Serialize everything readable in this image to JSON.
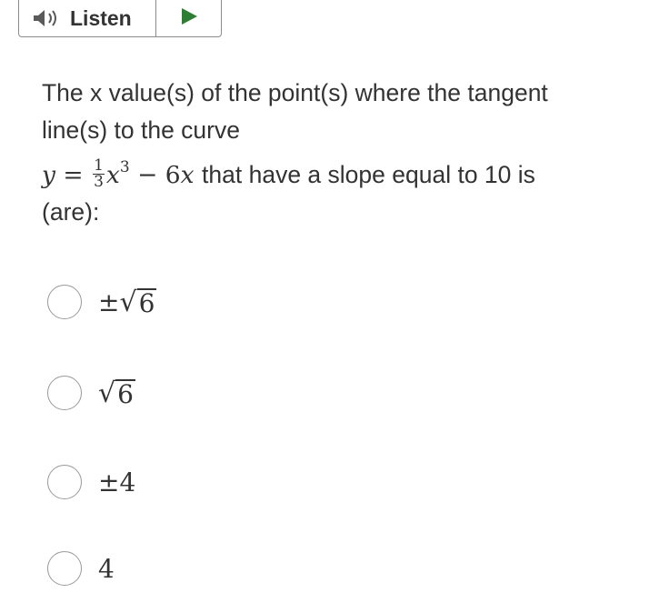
{
  "toolbar": {
    "listen_label": "Listen"
  },
  "question": {
    "line1": "The x value(s) of the point(s) where the tangent",
    "line2": "line(s) to the curve",
    "eq_y": "y",
    "eq_equals": "=",
    "frac_num": "1",
    "frac_den": "3",
    "eq_x": "x",
    "eq_exp": "3",
    "eq_minus": "−",
    "eq_coef": "6",
    "eq_x2": "x",
    "line3_tail": " that have a slope equal to 10 is",
    "line4": "(are):"
  },
  "options": [
    {
      "prefix": "±",
      "radicand": "6"
    },
    {
      "prefix": "",
      "radicand": "6"
    },
    {
      "text": "±4"
    },
    {
      "text": "4"
    }
  ],
  "icons": {
    "speaker": "speaker-icon",
    "play": "play-icon",
    "play_color": "#2e7d32"
  }
}
